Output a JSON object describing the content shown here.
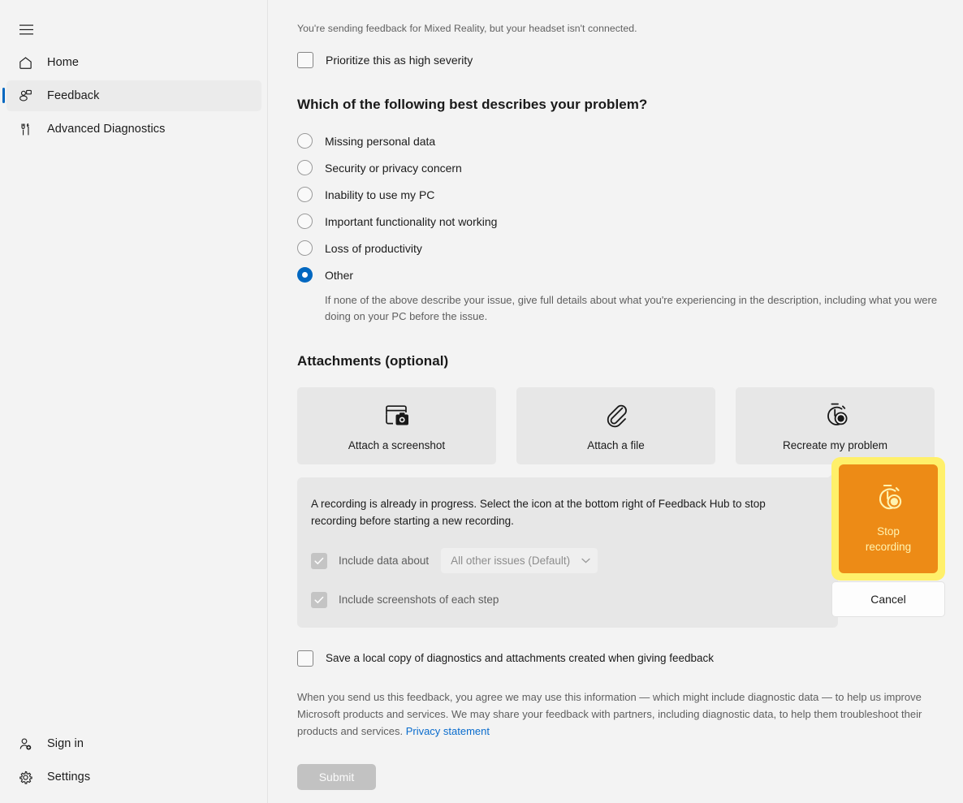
{
  "sidebar": {
    "menu_icon": "hamburger-menu-icon",
    "items": [
      {
        "label": "Home",
        "icon": "home-icon",
        "selected": false
      },
      {
        "label": "Feedback",
        "icon": "feedback-icon",
        "selected": true
      },
      {
        "label": "Advanced Diagnostics",
        "icon": "diagnostics-icon",
        "selected": false
      }
    ],
    "bottom_items": [
      {
        "label": "Sign in",
        "icon": "person-add-icon"
      },
      {
        "label": "Settings",
        "icon": "gear-icon"
      }
    ]
  },
  "main": {
    "notice": "You're sending feedback for Mixed Reality, but your headset isn't connected.",
    "prioritize": {
      "label": "Prioritize this as high severity",
      "checked": false
    },
    "problem_section": {
      "heading": "Which of the following best describes your problem?",
      "options": [
        {
          "label": "Missing personal data",
          "selected": false
        },
        {
          "label": "Security or privacy concern",
          "selected": false
        },
        {
          "label": "Inability to use my PC",
          "selected": false
        },
        {
          "label": "Important functionality not working",
          "selected": false
        },
        {
          "label": "Loss of productivity",
          "selected": false
        },
        {
          "label": "Other",
          "selected": true
        }
      ],
      "other_help": "If none of the above describe your issue, give full details about what you're experiencing in the description, including what you were doing on your PC before the issue."
    },
    "attachments": {
      "heading": "Attachments (optional)",
      "buttons": [
        {
          "label": "Attach a screenshot",
          "icon": "screenshot-camera-icon"
        },
        {
          "label": "Attach a file",
          "icon": "paperclip-icon"
        },
        {
          "label": "Recreate my problem",
          "icon": "stopwatch-record-icon"
        }
      ]
    },
    "recording_panel": {
      "message": "A recording is already in progress. Select the icon at the bottom right of Feedback Hub to stop recording before starting a new recording.",
      "include_data": {
        "label": "Include data about",
        "checked": true,
        "disabled": true,
        "dropdown_value": "All other issues (Default)",
        "dropdown_chevron": "chevron-down-icon"
      },
      "include_screenshots": {
        "label": "Include screenshots of each step",
        "checked": true,
        "disabled": true
      }
    },
    "stop_recording": {
      "label": "Stop recording",
      "label_line1": "Stop",
      "label_line2": "recording",
      "icon": "stopwatch-record-icon",
      "cancel_label": "Cancel",
      "highlight_color": "#fff06a",
      "button_color": "#ed8b16",
      "text_color": "#fff3b0"
    },
    "save_local_copy": {
      "label": "Save a local copy of diagnostics and attachments created when giving feedback",
      "checked": false
    },
    "legal": {
      "text": "When you send us this feedback, you agree we may use this information — which might include diagnostic data — to help us improve Microsoft products and services. We may share your feedback with partners, including diagnostic data, to help them troubleshoot their products and services. ",
      "link_label": "Privacy statement"
    },
    "submit": {
      "label": "Submit",
      "enabled": false
    }
  },
  "colors": {
    "accent": "#0067c0",
    "page_bg": "#f3f3f3",
    "panel_bg": "#e7e7e7",
    "link": "#0a6ccd"
  }
}
